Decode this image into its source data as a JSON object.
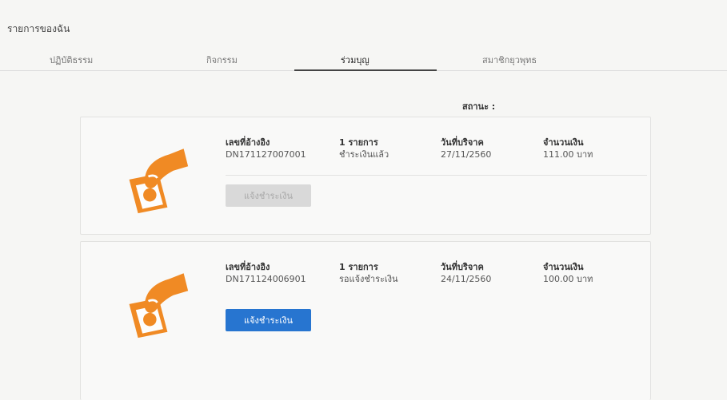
{
  "page": {
    "title": "รายการของฉัน"
  },
  "tabs": [
    {
      "label": "ปฏิบัติธรรม",
      "active": false
    },
    {
      "label": "กิจกรรม",
      "active": false
    },
    {
      "label": "ร่วมบุญ",
      "active": true
    },
    {
      "label": "สมาชิกยุวพุทธ",
      "active": false
    }
  ],
  "status": {
    "label": "สถานะ :"
  },
  "cards": [
    {
      "icon": "hand-giving-money-icon",
      "ref_label": "เลขที่อ้างอิง",
      "ref_value": "DN171127007001",
      "items_label": "1 รายการ",
      "items_value": "ชำระเงินแล้ว",
      "date_label": "วันที่บริจาค",
      "date_value": "27/11/2560",
      "amount_label": "จำนวนเงิน",
      "amount_value": "111.00 บาท",
      "button_label": "แจ้งชำระเงิน",
      "button_enabled": false
    },
    {
      "icon": "hand-giving-money-icon",
      "ref_label": "เลขที่อ้างอิง",
      "ref_value": "DN171124006901",
      "items_label": "1 รายการ",
      "items_value": "รอแจ้งชำระเงิน",
      "date_label": "วันที่บริจาค",
      "date_value": "24/11/2560",
      "amount_label": "จำนวนเงิน",
      "amount_value": "100.00 บาท",
      "button_label": "แจ้งชำระเงิน",
      "button_enabled": true
    }
  ],
  "colors": {
    "icon_orange": "#f08a24",
    "primary_button": "#2775d0",
    "disabled_button": "#d9d9d9"
  }
}
